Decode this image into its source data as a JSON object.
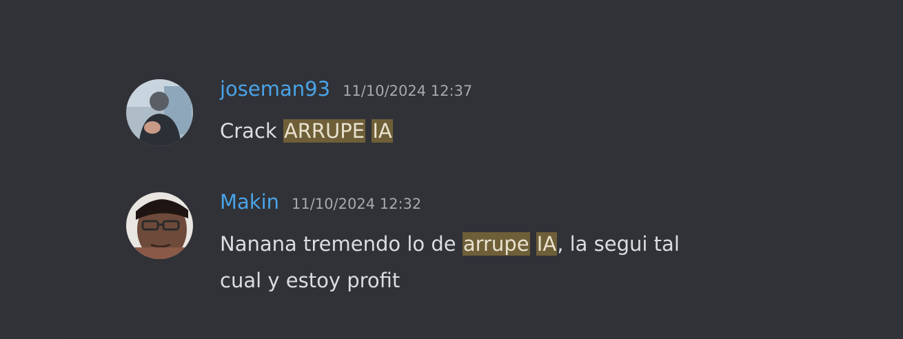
{
  "messages": [
    {
      "username": "joseman93",
      "timestamp": "11/10/2024 12:37",
      "username_color": "#4aa3e8",
      "avatar_icon": "user-avatar",
      "content": [
        {
          "text": "Crack ",
          "highlight": false
        },
        {
          "text": "ARRUPE",
          "highlight": true
        },
        {
          "text": " ",
          "highlight": false
        },
        {
          "text": "IA",
          "highlight": true
        }
      ]
    },
    {
      "username": "Makin",
      "timestamp": "11/10/2024 12:32",
      "username_color": "#4aa3e8",
      "avatar_icon": "user-avatar",
      "content": [
        {
          "text": "Nanana tremendo lo de ",
          "highlight": false
        },
        {
          "text": "arrupe",
          "highlight": true
        },
        {
          "text": " ",
          "highlight": false
        },
        {
          "text": "IA",
          "highlight": true
        },
        {
          "text": ", la segui tal cual y estoy profit",
          "highlight": false
        }
      ]
    }
  ],
  "colors": {
    "background": "#313338",
    "highlight": "#6f5f38",
    "text": "#dbdee1",
    "timestamp": "#a6a9ae"
  }
}
